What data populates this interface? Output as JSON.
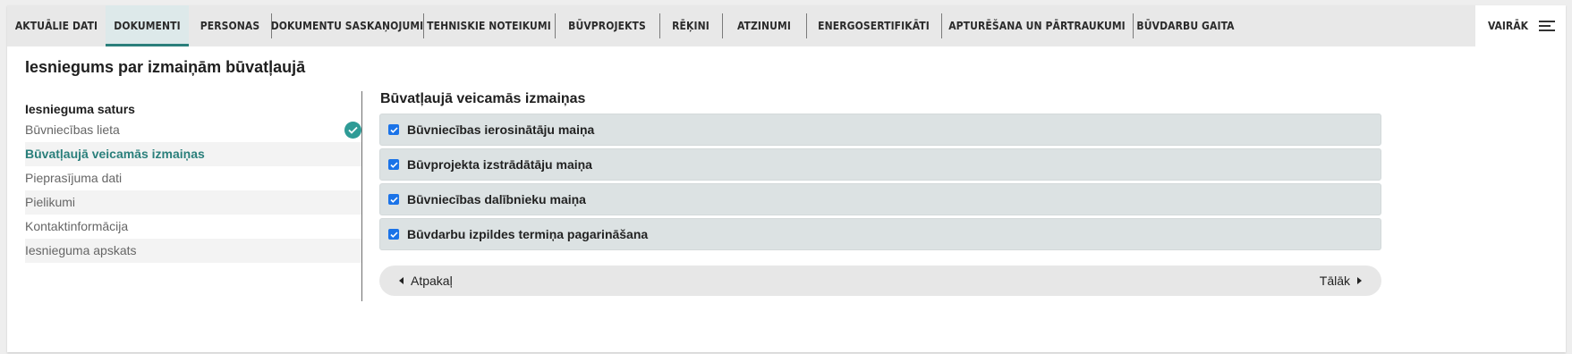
{
  "tabs": [
    {
      "label": "Aktuālie dati"
    },
    {
      "label": "Dokumenti"
    },
    {
      "label": "Personas"
    },
    {
      "label": "Dokumentu saskaņojumi"
    },
    {
      "label": "Tehniskie noteikumi"
    },
    {
      "label": "Būvprojekts"
    },
    {
      "label": "Rēķini"
    },
    {
      "label": "Atzinumi"
    },
    {
      "label": "Energosertifikāti"
    },
    {
      "label": "Apturēšana un pārtraukumi"
    },
    {
      "label": "Būvdarbu gaita"
    }
  ],
  "active_tab": "Dokumenti",
  "more": {
    "label": "Vairāk",
    "icon": "menu-icon"
  },
  "page_title": "Iesniegums par izmaiņām būvatļaujā",
  "sidebar": {
    "heading": "Iesnieguma saturs",
    "items": [
      {
        "label": "Būvniecības lieta",
        "status": "completed",
        "icon": "check-circle-icon"
      },
      {
        "label": "Būvatļaujā veicamās izmaiņas",
        "status": "active"
      },
      {
        "label": "Pieprasījuma dati"
      },
      {
        "label": "Pielikumi"
      },
      {
        "label": "Kontaktinformācija"
      },
      {
        "label": "Iesnieguma apskats"
      }
    ]
  },
  "content": {
    "section_title": "Būvatļaujā veicamās izmaiņas",
    "options": [
      {
        "label": "Būvniecības ierosinātāju maiņa",
        "checked": true
      },
      {
        "label": "Būvprojekta izstrādātāju maiņa",
        "checked": true
      },
      {
        "label": "Būvniecības dalībnieku maiņa",
        "checked": true
      },
      {
        "label": "Būvdarbu izpildes termiņa pagarināšana",
        "checked": true
      }
    ]
  },
  "nav": {
    "back_label": "Atpakaļ",
    "next_label": "Tālāk"
  },
  "colors": {
    "accent": "#2a7f7b",
    "check_done": "#2e9b96",
    "checkbox": "#1a73e8",
    "tab_active_bg": "#dde9ea",
    "option_bg": "#dce2e3"
  }
}
